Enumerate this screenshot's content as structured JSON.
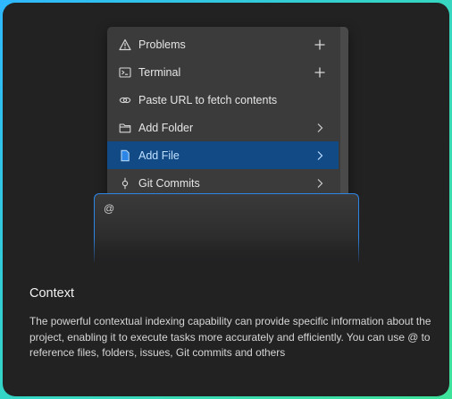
{
  "menu": {
    "items": [
      {
        "label": "Problems",
        "icon": "warning-triangle-icon",
        "action": "plus-icon"
      },
      {
        "label": "Terminal",
        "icon": "terminal-icon",
        "action": "plus-icon"
      },
      {
        "label": "Paste URL to fetch contents",
        "icon": "link-icon",
        "action": ""
      },
      {
        "label": "Add Folder",
        "icon": "folder-icon",
        "action": "chevron-right-icon"
      },
      {
        "label": "Add File",
        "icon": "file-icon",
        "action": "chevron-right-icon",
        "active": true
      },
      {
        "label": "Git Commits",
        "icon": "git-commit-icon",
        "action": "chevron-right-icon"
      }
    ]
  },
  "input": {
    "value": "@"
  },
  "info": {
    "title": "Context",
    "description": "The powerful contextual indexing capability can provide specific information about the project, enabling it to execute tasks more accurately and efficiently. You can use @ to reference files, folders, issues, Git commits and others"
  },
  "colors": {
    "accent": "#2d86e6",
    "active_item": "#124a86",
    "card_bg": "#222223",
    "menu_bg": "#3b3b3c"
  }
}
